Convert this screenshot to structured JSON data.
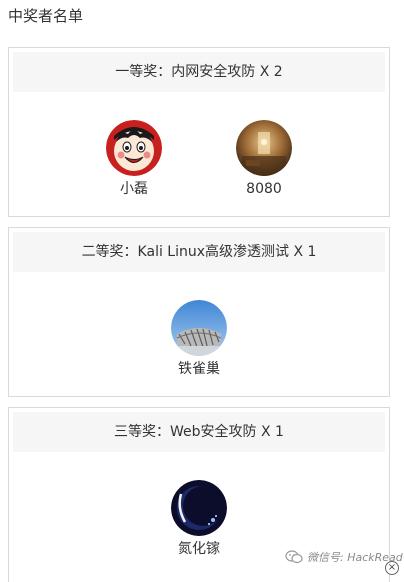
{
  "page": {
    "title": "中奖者名单"
  },
  "prizes": [
    {
      "header": "一等奖：内网安全攻防 X 2",
      "winners": [
        {
          "name": "小磊",
          "avatar_icon": "cartoon-face-avatar"
        },
        {
          "name": "8080",
          "avatar_icon": "warm-room-photo-avatar"
        }
      ]
    },
    {
      "header": "二等奖：Kali Linux高级渗透测试 X 1",
      "winners": [
        {
          "name": "铁雀巢",
          "avatar_icon": "stadium-photo-avatar"
        }
      ]
    },
    {
      "header": "三等奖：Web安全攻防 X 1",
      "winners": [
        {
          "name": "氮化镓",
          "avatar_icon": "moon-night-avatar"
        }
      ]
    }
  ],
  "watermark": {
    "text": "微信号: HackRead",
    "icon": "wechat-icon"
  },
  "close": {
    "label": "×",
    "icon": "close-icon"
  },
  "colors": {
    "border": "#d9d9d9",
    "header_bg": "#f6f6f6",
    "text": "#333333"
  }
}
